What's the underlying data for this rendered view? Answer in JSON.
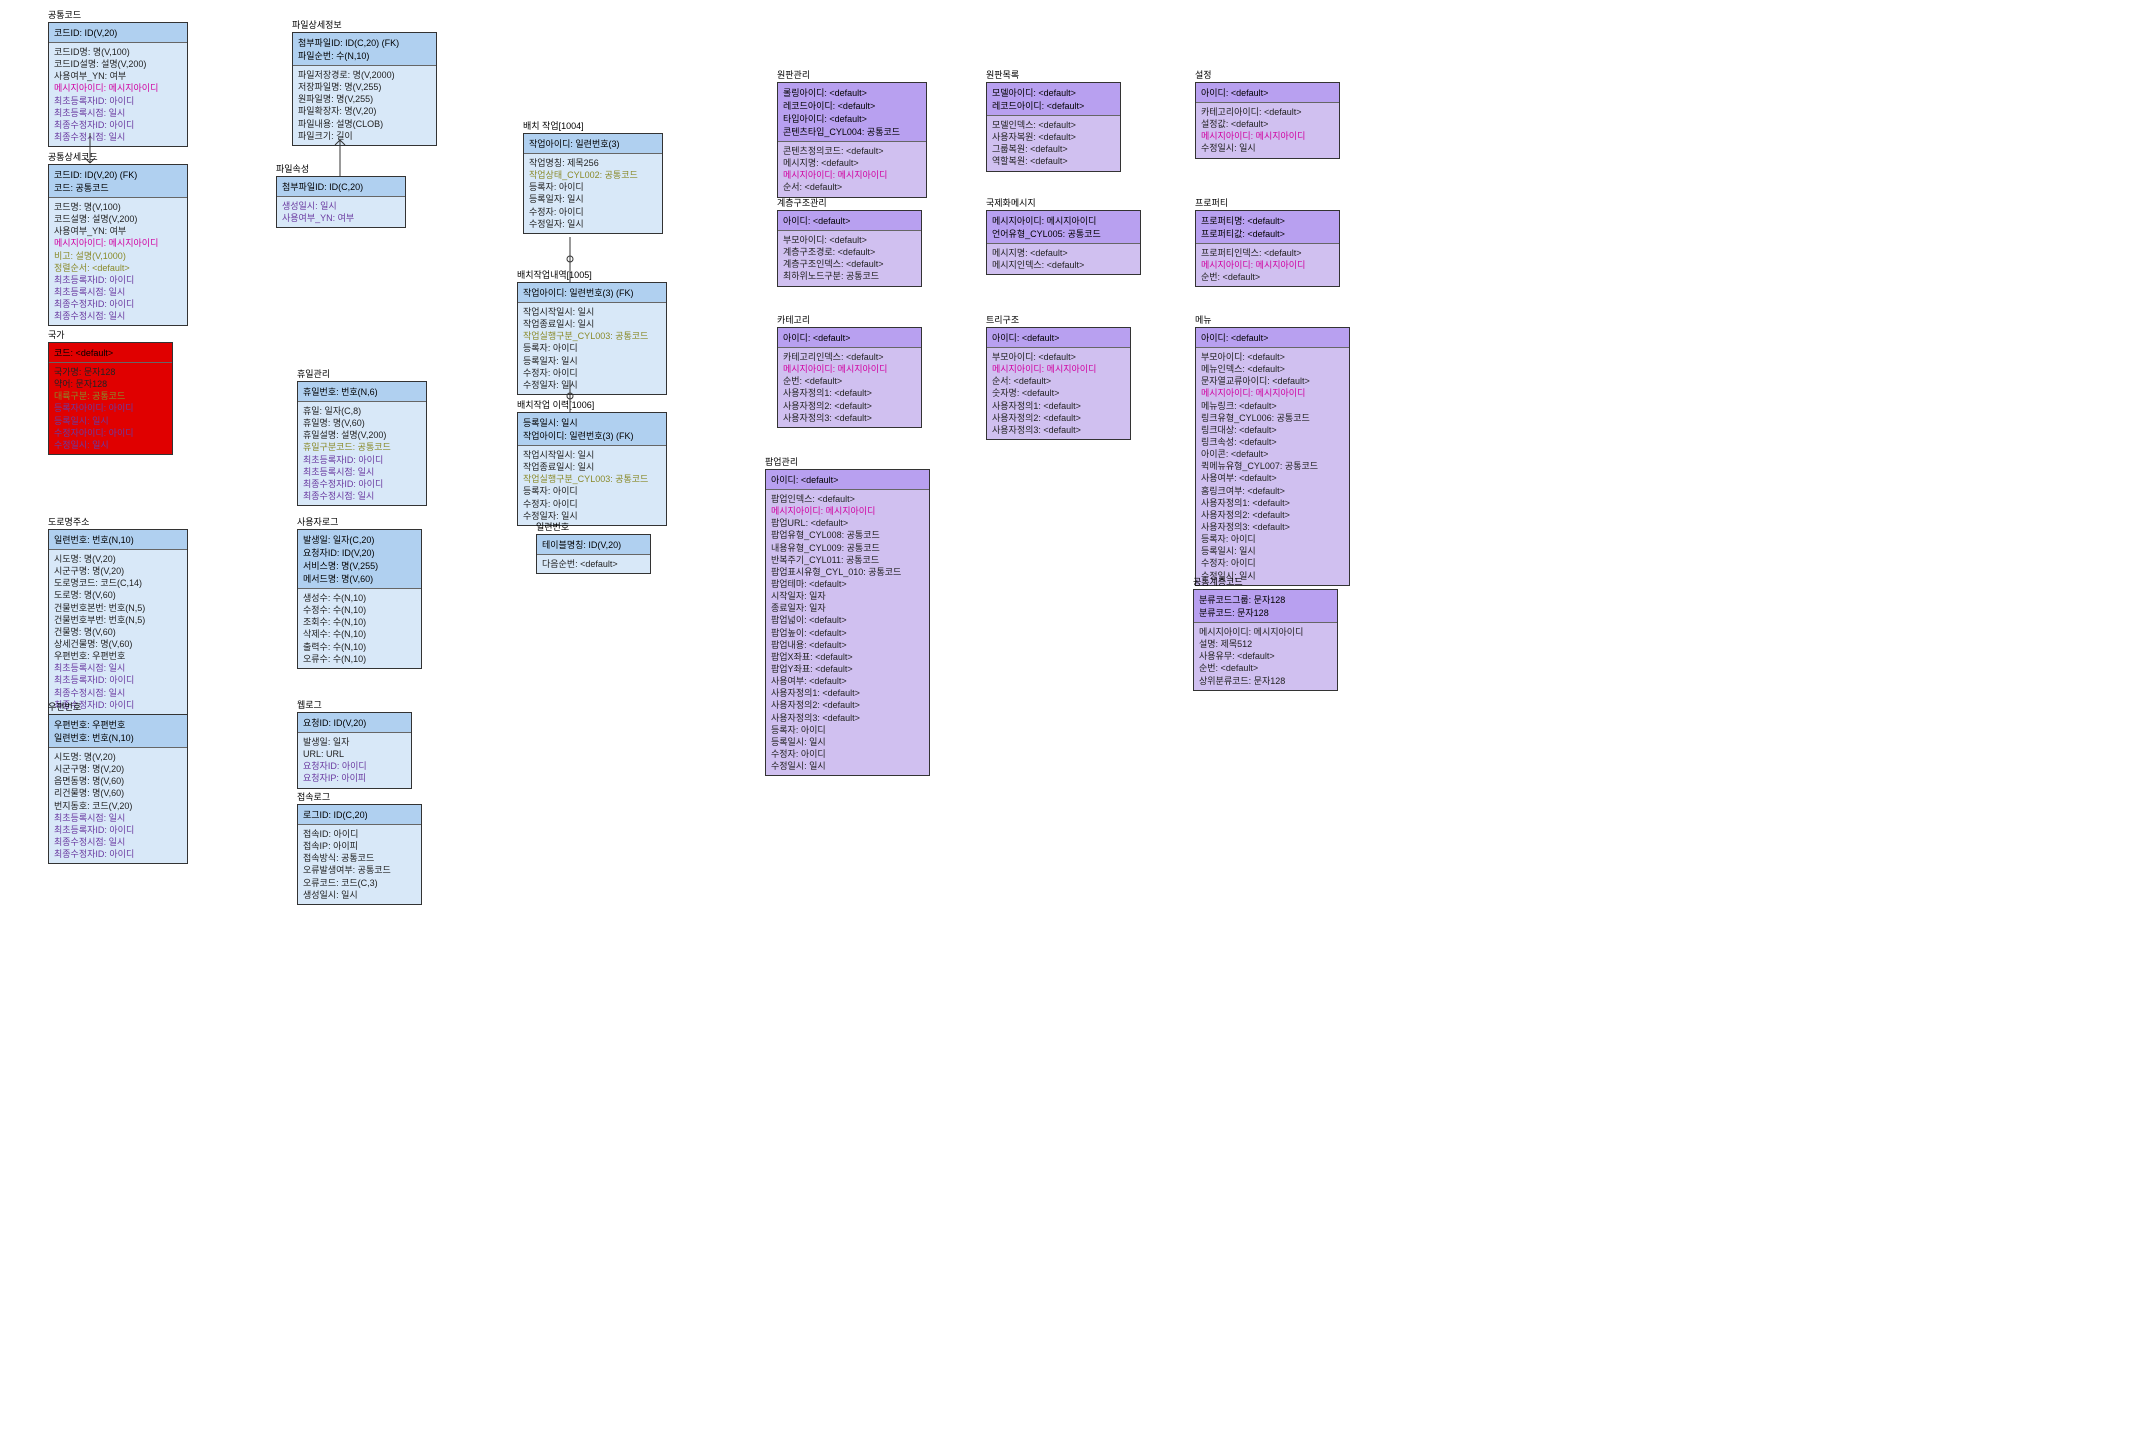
{
  "entities": {
    "e1": {
      "title": "공통코드",
      "header": "코드ID: ID(V,20)",
      "rows": [
        {
          "t": "코드ID명: 명(V,100)",
          "c": "c-dark"
        },
        {
          "t": "코드ID설명: 설명(V,200)",
          "c": "c-dark"
        },
        {
          "t": "사용여부_YN: 여부",
          "c": "c-dark"
        },
        {
          "t": "메시지아이디: 메시지아이디",
          "c": "c-pink"
        },
        {
          "t": "최초등록자ID: 아이디",
          "c": "c-purple"
        },
        {
          "t": "최초등록시점: 일시",
          "c": "c-purple"
        },
        {
          "t": "최종수정자ID: 아이디",
          "c": "c-purple"
        },
        {
          "t": "최종수정시점: 일시",
          "c": "c-purple"
        }
      ]
    },
    "e2": {
      "title": "공통상세코드",
      "header": "코드ID: ID(V,20) (FK)\n코드: 공통코드",
      "rows": [
        {
          "t": "코드명: 명(V,100)",
          "c": "c-dark"
        },
        {
          "t": "코드설명: 설명(V,200)",
          "c": "c-dark"
        },
        {
          "t": "사용여부_YN: 여부",
          "c": "c-dark"
        },
        {
          "t": "메시지아이디: 메시지아이디",
          "c": "c-pink"
        },
        {
          "t": "비고: 설명(V,1000)",
          "c": "c-olive"
        },
        {
          "t": "정렬순서: <default>",
          "c": "c-olive"
        },
        {
          "t": "최초등록자ID: 아이디",
          "c": "c-purple"
        },
        {
          "t": "최초등록시점: 일시",
          "c": "c-purple"
        },
        {
          "t": "최종수정자ID: 아이디",
          "c": "c-purple"
        },
        {
          "t": "최종수정시점: 일시",
          "c": "c-purple"
        }
      ]
    },
    "e3": {
      "title": "국가",
      "header": "코드: <default>",
      "rows": [
        {
          "t": "국가명: 문자128",
          "c": "c-dark"
        },
        {
          "t": "약어: 문자128",
          "c": "c-dark"
        },
        {
          "t": "대륙구분: 공통코드",
          "c": "c-olive"
        },
        {
          "t": "등록자아이디: 아이디",
          "c": "c-purple"
        },
        {
          "t": "등록일시: 일시",
          "c": "c-purple"
        },
        {
          "t": "수정자아이디: 아이디",
          "c": "c-purple"
        },
        {
          "t": "수정일시: 일시",
          "c": "c-purple"
        }
      ]
    },
    "e4": {
      "title": "도로명주소",
      "header": "일련번호: 번호(N,10)",
      "rows": [
        {
          "t": "시도명: 명(V,20)",
          "c": "c-dark"
        },
        {
          "t": "시군구명: 명(V,20)",
          "c": "c-dark"
        },
        {
          "t": "도로명코드: 코드(C,14)",
          "c": "c-dark"
        },
        {
          "t": "도로명: 명(V,60)",
          "c": "c-dark"
        },
        {
          "t": "건물번호본번: 번호(N,5)",
          "c": "c-dark"
        },
        {
          "t": "건물번호부번: 번호(N,5)",
          "c": "c-dark"
        },
        {
          "t": "건물명: 명(V,60)",
          "c": "c-dark"
        },
        {
          "t": "상세건물명: 명(V,60)",
          "c": "c-dark"
        },
        {
          "t": "우편번호: 우편번호",
          "c": "c-dark"
        },
        {
          "t": "최초등록시점: 일시",
          "c": "c-purple"
        },
        {
          "t": "최초등록자ID: 아이디",
          "c": "c-purple"
        },
        {
          "t": "최종수정시점: 일시",
          "c": "c-purple"
        },
        {
          "t": "최종수정자ID: 아이디",
          "c": "c-purple"
        }
      ]
    },
    "e5": {
      "title": "우편번호",
      "header": "우편번호: 우편번호\n일련번호: 번호(N,10)",
      "rows": [
        {
          "t": "시도명: 명(V,20)",
          "c": "c-dark"
        },
        {
          "t": "시군구명: 명(V,20)",
          "c": "c-dark"
        },
        {
          "t": "읍면동명: 명(V,60)",
          "c": "c-dark"
        },
        {
          "t": "리건물명: 명(V,60)",
          "c": "c-dark"
        },
        {
          "t": "번지동호: 코드(V,20)",
          "c": "c-dark"
        },
        {
          "t": "최초등록시점: 일시",
          "c": "c-purple"
        },
        {
          "t": "최초등록자ID: 아이디",
          "c": "c-purple"
        },
        {
          "t": "최종수정시점: 일시",
          "c": "c-purple"
        },
        {
          "t": "최종수정자ID: 아이디",
          "c": "c-purple"
        }
      ]
    },
    "e6": {
      "title": "파일상세정보",
      "header": "첨부파일ID: ID(C,20) (FK)\n파일순번: 수(N,10)",
      "rows": [
        {
          "t": "파일저장경로: 명(V,2000)",
          "c": "c-dark"
        },
        {
          "t": "저장파일명: 명(V,255)",
          "c": "c-dark"
        },
        {
          "t": "원파일명: 명(V,255)",
          "c": "c-dark"
        },
        {
          "t": "파일확장자: 명(V,20)",
          "c": "c-dark"
        },
        {
          "t": "파일내용: 설명(CLOB)",
          "c": "c-dark"
        },
        {
          "t": "파일크기: 길이",
          "c": "c-dark"
        }
      ]
    },
    "e7": {
      "title": "파일속성",
      "header": "첨부파일ID: ID(C,20)",
      "rows": [
        {
          "t": "생성일시: 일시",
          "c": "c-purple"
        },
        {
          "t": "사용여부_YN: 여부",
          "c": "c-purple"
        }
      ]
    },
    "e8": {
      "title": "휴일관리",
      "header": "휴일번호: 번호(N,6)",
      "rows": [
        {
          "t": "휴일: 일자(C,8)",
          "c": "c-dark"
        },
        {
          "t": "휴일명: 명(V,60)",
          "c": "c-dark"
        },
        {
          "t": "휴일설명: 설명(V,200)",
          "c": "c-dark"
        },
        {
          "t": "휴일구분코드: 공통코드",
          "c": "c-olive"
        },
        {
          "t": "최초등록자ID: 아이디",
          "c": "c-purple"
        },
        {
          "t": "최초등록시점: 일시",
          "c": "c-purple"
        },
        {
          "t": "최종수정자ID: 아이디",
          "c": "c-purple"
        },
        {
          "t": "최종수정시점: 일시",
          "c": "c-purple"
        }
      ]
    },
    "e9": {
      "title": "사용자로그",
      "header": "발생일: 일자(C,20)\n요청자ID: ID(V,20)\n서비스명: 명(V,255)\n메서드명: 명(V,60)",
      "rows": [
        {
          "t": "생성수: 수(N,10)",
          "c": "c-dark"
        },
        {
          "t": "수정수: 수(N,10)",
          "c": "c-dark"
        },
        {
          "t": "조회수: 수(N,10)",
          "c": "c-dark"
        },
        {
          "t": "삭제수: 수(N,10)",
          "c": "c-dark"
        },
        {
          "t": "출력수: 수(N,10)",
          "c": "c-dark"
        },
        {
          "t": "오류수: 수(N,10)",
          "c": "c-dark"
        }
      ]
    },
    "e10": {
      "title": "웹로그",
      "header": "요청ID: ID(V,20)",
      "rows": [
        {
          "t": "발생일: 일자",
          "c": "c-dark"
        },
        {
          "t": "URL: URL",
          "c": "c-dark"
        },
        {
          "t": "요청자ID: 아이디",
          "c": "c-purple"
        },
        {
          "t": "요청자IP: 아이피",
          "c": "c-purple"
        }
      ]
    },
    "e11": {
      "title": "접속로그",
      "header": "로그ID: ID(C,20)",
      "rows": [
        {
          "t": "접속ID: 아이디",
          "c": "c-dark"
        },
        {
          "t": "접속IP: 아이피",
          "c": "c-dark"
        },
        {
          "t": "접속방식: 공통코드",
          "c": "c-dark"
        },
        {
          "t": "오류발생여부: 공통코드",
          "c": "c-dark"
        },
        {
          "t": "오류코드: 코드(C,3)",
          "c": "c-dark"
        },
        {
          "t": "생성일시: 일시",
          "c": "c-dark"
        }
      ]
    },
    "e12": {
      "title": "배치 작업[1004]",
      "header": "작업아이디: 일련번호(3)",
      "rows": [
        {
          "t": "작업명칭: 제목256",
          "c": "c-dark"
        },
        {
          "t": "작업상태_CYL002: 공통코드",
          "c": "c-olive"
        },
        {
          "t": "등록자: 아이디",
          "c": "c-dark"
        },
        {
          "t": "등록일자: 일시",
          "c": "c-dark"
        },
        {
          "t": "수정자: 아이디",
          "c": "c-dark"
        },
        {
          "t": "수정일자: 일시",
          "c": "c-dark"
        }
      ]
    },
    "e13": {
      "title": "배치작업내역[1005]",
      "header": "작업아이디: 일련번호(3) (FK)",
      "rows": [
        {
          "t": "작업시작일시: 일시",
          "c": "c-dark"
        },
        {
          "t": "작업종료일시: 일시",
          "c": "c-dark"
        },
        {
          "t": "작업실행구분_CYL003: 공통코드",
          "c": "c-olive"
        },
        {
          "t": "등록자: 아이디",
          "c": "c-dark"
        },
        {
          "t": "등록일자: 일시",
          "c": "c-dark"
        },
        {
          "t": "수정자: 아이디",
          "c": "c-dark"
        },
        {
          "t": "수정일자: 일시",
          "c": "c-dark"
        }
      ]
    },
    "e14": {
      "title": "배치작업 이력[1006]",
      "header": "등록일시: 일시\n작업아이디: 일련번호(3) (FK)",
      "rows": [
        {
          "t": "작업시작일시: 일시",
          "c": "c-dark"
        },
        {
          "t": "작업종료일시: 일시",
          "c": "c-dark"
        },
        {
          "t": "작업실행구분_CYL003: 공통코드",
          "c": "c-olive"
        },
        {
          "t": "등록자: 아이디",
          "c": "c-dark"
        },
        {
          "t": "수정자: 아이디",
          "c": "c-dark"
        },
        {
          "t": "수정일자: 일시",
          "c": "c-dark"
        }
      ]
    },
    "e15": {
      "title": "일련번호",
      "header": "테이블명칭: ID(V,20)",
      "rows": [
        {
          "t": "다음순번: <default>",
          "c": "c-dark"
        }
      ]
    },
    "e16": {
      "title": "원판관리",
      "header": "롤링아이디: <default>\n레코드아이디: <default>\n타입아이디: <default>\n콘텐츠타입_CYL004: 공통코드",
      "rows": [
        {
          "t": "콘텐츠정의코드: <default>",
          "c": "c-dark"
        },
        {
          "t": "메시지명: <default>",
          "c": "c-dark"
        },
        {
          "t": "메시지아이디: 메시지아이디",
          "c": "c-pink"
        },
        {
          "t": "순서: <default>",
          "c": "c-dark"
        }
      ]
    },
    "e17": {
      "title": "원판목록",
      "header": "모델아이디: <default>\n레코드아이디: <default>",
      "rows": [
        {
          "t": "모델인덱스: <default>",
          "c": "c-dark"
        },
        {
          "t": "사용자복원: <default>",
          "c": "c-dark"
        },
        {
          "t": "그룹복원: <default>",
          "c": "c-dark"
        },
        {
          "t": "역할복원: <default>",
          "c": "c-dark"
        }
      ]
    },
    "e18": {
      "title": "설정",
      "header": "아이디: <default>",
      "rows": [
        {
          "t": "카테고리아이디: <default>",
          "c": "c-dark"
        },
        {
          "t": "설정값: <default>",
          "c": "c-dark"
        },
        {
          "t": "메시지아이디: 메시지아이디",
          "c": "c-pink"
        },
        {
          "t": "수정일시: 일시",
          "c": "c-dark"
        }
      ]
    },
    "e19": {
      "title": "계층구조관리",
      "header": "아이디: <default>",
      "rows": [
        {
          "t": "부모아이디: <default>",
          "c": "c-dark"
        },
        {
          "t": "계층구조경로: <default>",
          "c": "c-dark"
        },
        {
          "t": "계층구조인덱스: <default>",
          "c": "c-dark"
        },
        {
          "t": "최하위노드구분: 공통코드",
          "c": "c-dark"
        }
      ]
    },
    "e20": {
      "title": "국제화메시지",
      "header": "메시지아이디: 메시지아이디\n언어유형_CYL005: 공통코드",
      "rows": [
        {
          "t": "메시지명: <default>",
          "c": "c-dark"
        },
        {
          "t": "메시지인덱스: <default>",
          "c": "c-dark"
        }
      ]
    },
    "e21": {
      "title": "프로퍼티",
      "header": "프로퍼티명: <default>\n프로퍼티값: <default>",
      "rows": [
        {
          "t": "프로퍼티인덱스: <default>",
          "c": "c-dark"
        },
        {
          "t": "메시지아이디: 메시지아이디",
          "c": "c-pink"
        },
        {
          "t": "순번: <default>",
          "c": "c-dark"
        }
      ]
    },
    "e22": {
      "title": "카테고리",
      "header": "아이디: <default>",
      "rows": [
        {
          "t": "카테고리인덱스: <default>",
          "c": "c-dark"
        },
        {
          "t": "메시지아이디: 메시지아이디",
          "c": "c-pink"
        },
        {
          "t": "순번: <default>",
          "c": "c-dark"
        },
        {
          "t": "사용자정의1: <default>",
          "c": "c-dark"
        },
        {
          "t": "사용자정의2: <default>",
          "c": "c-dark"
        },
        {
          "t": "사용자정의3: <default>",
          "c": "c-dark"
        }
      ]
    },
    "e23": {
      "title": "트리구조",
      "header": "아이디: <default>",
      "rows": [
        {
          "t": "부모아이디: <default>",
          "c": "c-dark"
        },
        {
          "t": "메시지아이디: 메시지아이디",
          "c": "c-pink"
        },
        {
          "t": "순서: <default>",
          "c": "c-dark"
        },
        {
          "t": "숫자명: <default>",
          "c": "c-dark"
        },
        {
          "t": "사용자정의1: <default>",
          "c": "c-dark"
        },
        {
          "t": "사용자정의2: <default>",
          "c": "c-dark"
        },
        {
          "t": "사용자정의3: <default>",
          "c": "c-dark"
        }
      ]
    },
    "e24": {
      "title": "메뉴",
      "header": "아이디: <default>",
      "rows": [
        {
          "t": "부모아이디: <default>",
          "c": "c-dark"
        },
        {
          "t": "메뉴인덱스: <default>",
          "c": "c-dark"
        },
        {
          "t": "문자열교류아이디: <default>",
          "c": "c-dark"
        },
        {
          "t": "메시지아이디: 메시지아이디",
          "c": "c-pink"
        },
        {
          "t": "메뉴링크: <default>",
          "c": "c-dark"
        },
        {
          "t": "링크유형_CYL006: 공통코드",
          "c": "c-dark"
        },
        {
          "t": "링크대상: <default>",
          "c": "c-dark"
        },
        {
          "t": "링크속성: <default>",
          "c": "c-dark"
        },
        {
          "t": "아이콘: <default>",
          "c": "c-dark"
        },
        {
          "t": "퀵메뉴유형_CYL007: 공통코드",
          "c": "c-dark"
        },
        {
          "t": "사용여부: <default>",
          "c": "c-dark"
        },
        {
          "t": "홈링크여부: <default>",
          "c": "c-dark"
        },
        {
          "t": "사용자정의1: <default>",
          "c": "c-dark"
        },
        {
          "t": "사용자정의2: <default>",
          "c": "c-dark"
        },
        {
          "t": "사용자정의3: <default>",
          "c": "c-dark"
        },
        {
          "t": "등록자: 아이디",
          "c": "c-dark"
        },
        {
          "t": "등록일시: 일시",
          "c": "c-dark"
        },
        {
          "t": "수정자: 아이디",
          "c": "c-dark"
        },
        {
          "t": "수정일시: 일시",
          "c": "c-dark"
        }
      ]
    },
    "e25": {
      "title": "팝업관리",
      "header": "아이디: <default>",
      "rows": [
        {
          "t": "팝업인덱스: <default>",
          "c": "c-dark"
        },
        {
          "t": "메시지아이디: 메시지아이디",
          "c": "c-pink"
        },
        {
          "t": "팝업URL: <default>",
          "c": "c-dark"
        },
        {
          "t": "팝업유형_CYL008: 공통코드",
          "c": "c-dark"
        },
        {
          "t": "내용유형_CYL009: 공통코드",
          "c": "c-dark"
        },
        {
          "t": "반복주기_CYL011: 공통코드",
          "c": "c-dark"
        },
        {
          "t": "팝업표시유형_CYL_010: 공통코드",
          "c": "c-dark"
        },
        {
          "t": "팝업테마: <default>",
          "c": "c-dark"
        },
        {
          "t": "시작일자: 일자",
          "c": "c-dark"
        },
        {
          "t": "종료일자: 일자",
          "c": "c-dark"
        },
        {
          "t": "팝업넓이: <default>",
          "c": "c-dark"
        },
        {
          "t": "팝업높이: <default>",
          "c": "c-dark"
        },
        {
          "t": "팝업내용: <default>",
          "c": "c-dark"
        },
        {
          "t": "팝업X좌표: <default>",
          "c": "c-dark"
        },
        {
          "t": "팝업Y좌표: <default>",
          "c": "c-dark"
        },
        {
          "t": "사용여부: <default>",
          "c": "c-dark"
        },
        {
          "t": "사용자정의1: <default>",
          "c": "c-dark"
        },
        {
          "t": "사용자정의2: <default>",
          "c": "c-dark"
        },
        {
          "t": "사용자정의3: <default>",
          "c": "c-dark"
        },
        {
          "t": "등록자: 아이디",
          "c": "c-dark"
        },
        {
          "t": "등록일시: 일시",
          "c": "c-dark"
        },
        {
          "t": "수정자: 아이디",
          "c": "c-dark"
        },
        {
          "t": "수정일시: 일시",
          "c": "c-dark"
        }
      ]
    },
    "e26": {
      "title": "공통계층코드",
      "header": "분류코드그룹: 문자128\n분류코드: 문자128",
      "rows": [
        {
          "t": "메시지아이디: 메시지아이디",
          "c": "c-dark"
        },
        {
          "t": "설명: 제목512",
          "c": "c-dark"
        },
        {
          "t": "사용유무: <default>",
          "c": "c-dark"
        },
        {
          "t": "순번: <default>",
          "c": "c-dark"
        },
        {
          "t": "상위분류코드: 문자128",
          "c": "c-dark"
        }
      ]
    }
  }
}
